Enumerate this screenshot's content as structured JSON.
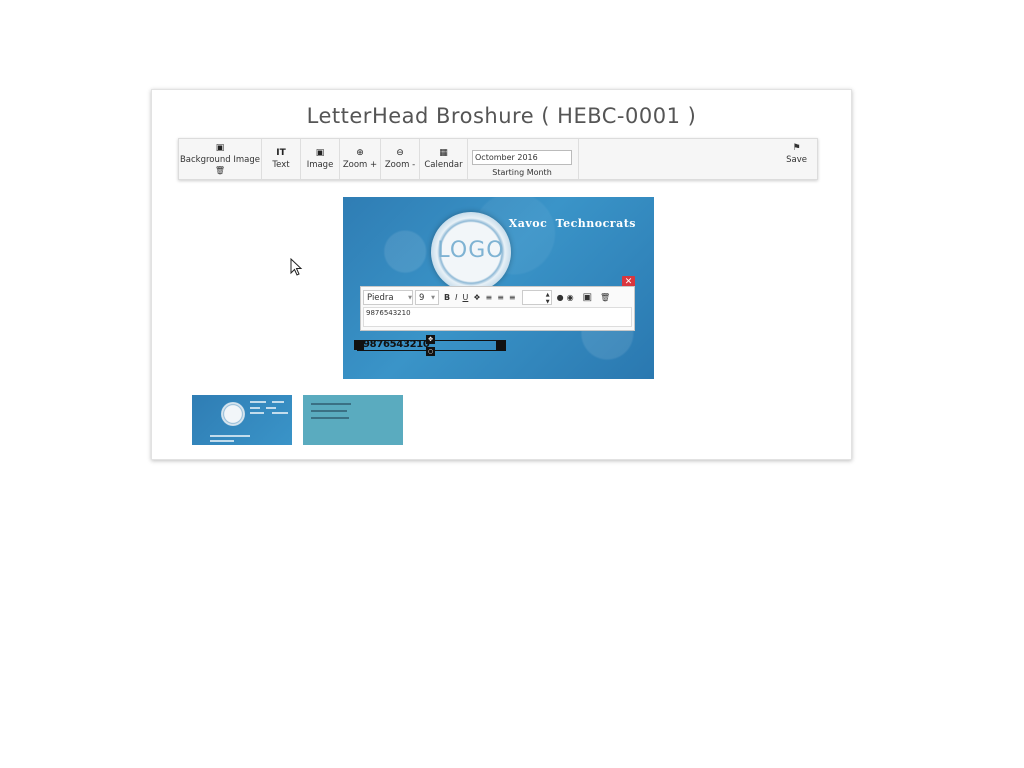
{
  "page": {
    "title": "LetterHead Broshure ( HEBC-0001 )"
  },
  "toolbar": {
    "background_image": {
      "label": "Background Image",
      "icon": "image-icon",
      "sub_icon": "trash-icon"
    },
    "text": {
      "label": "Text",
      "icon": "text-icon"
    },
    "image": {
      "label": "Image",
      "icon": "image-icon"
    },
    "zoom_in": {
      "label": "Zoom +",
      "icon": "zoom-in-icon"
    },
    "zoom_out": {
      "label": "Zoom -",
      "icon": "zoom-out-icon"
    },
    "calendar": {
      "label": "Calendar",
      "icon": "calendar-icon"
    },
    "month_value": "Octomber 2016",
    "month_label": "Starting Month",
    "save": {
      "label": "Save",
      "icon": "flag-icon"
    }
  },
  "canvas": {
    "logo": "LOGO",
    "company": "Xavoc  Technocrats",
    "editor": {
      "font": "Piedra",
      "size": "9",
      "buttons": [
        "B",
        "I",
        "U"
      ],
      "text": "9876543210"
    },
    "selected_text": "9876543210"
  },
  "colors": {
    "canvas": "#3a8fc3",
    "close": "#d9363e",
    "thumb2": "#5aabbf"
  }
}
